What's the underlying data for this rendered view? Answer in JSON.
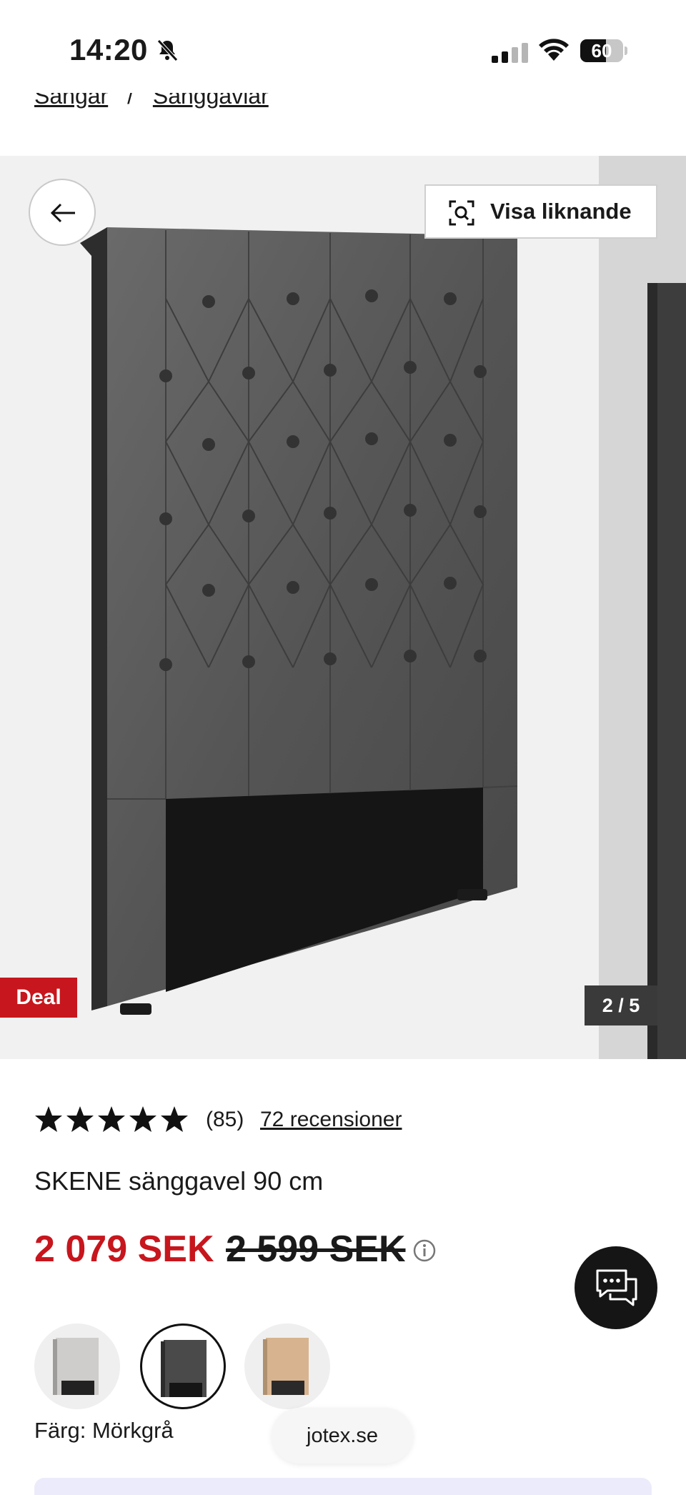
{
  "status_bar": {
    "time": "14:20",
    "battery_level": "60",
    "battery_fraction": 0.6
  },
  "breadcrumb": {
    "items": [
      "Sängar",
      "Sänggavlar"
    ],
    "separator": "/"
  },
  "gallery": {
    "back_label": "Tillbaka",
    "visa_liknande_label": "Visa liknande",
    "deal_badge": "Deal",
    "page_counter": "2 / 5"
  },
  "product": {
    "rating_stars": 5,
    "rating_count": "(85)",
    "reviews_link": "72 recensioner",
    "title": "SKENE sänggavel 90 cm",
    "sale_price": "2 079 SEK",
    "old_price": "2 599 SEK",
    "color_label": "Färg: Mörkgrå",
    "swatches": [
      {
        "name": "Ljusgrå",
        "color": "#cfcdcb"
      },
      {
        "name": "Mörkgrå",
        "color": "#4a4a4a",
        "selected": true
      },
      {
        "name": "Beige",
        "color": "#d7b48f"
      }
    ]
  },
  "browser": {
    "domain": "jotex.se"
  },
  "colors": {
    "accent_red": "#c7161d",
    "dark": "#151515",
    "gallery_bg": "#f1f1f1"
  }
}
